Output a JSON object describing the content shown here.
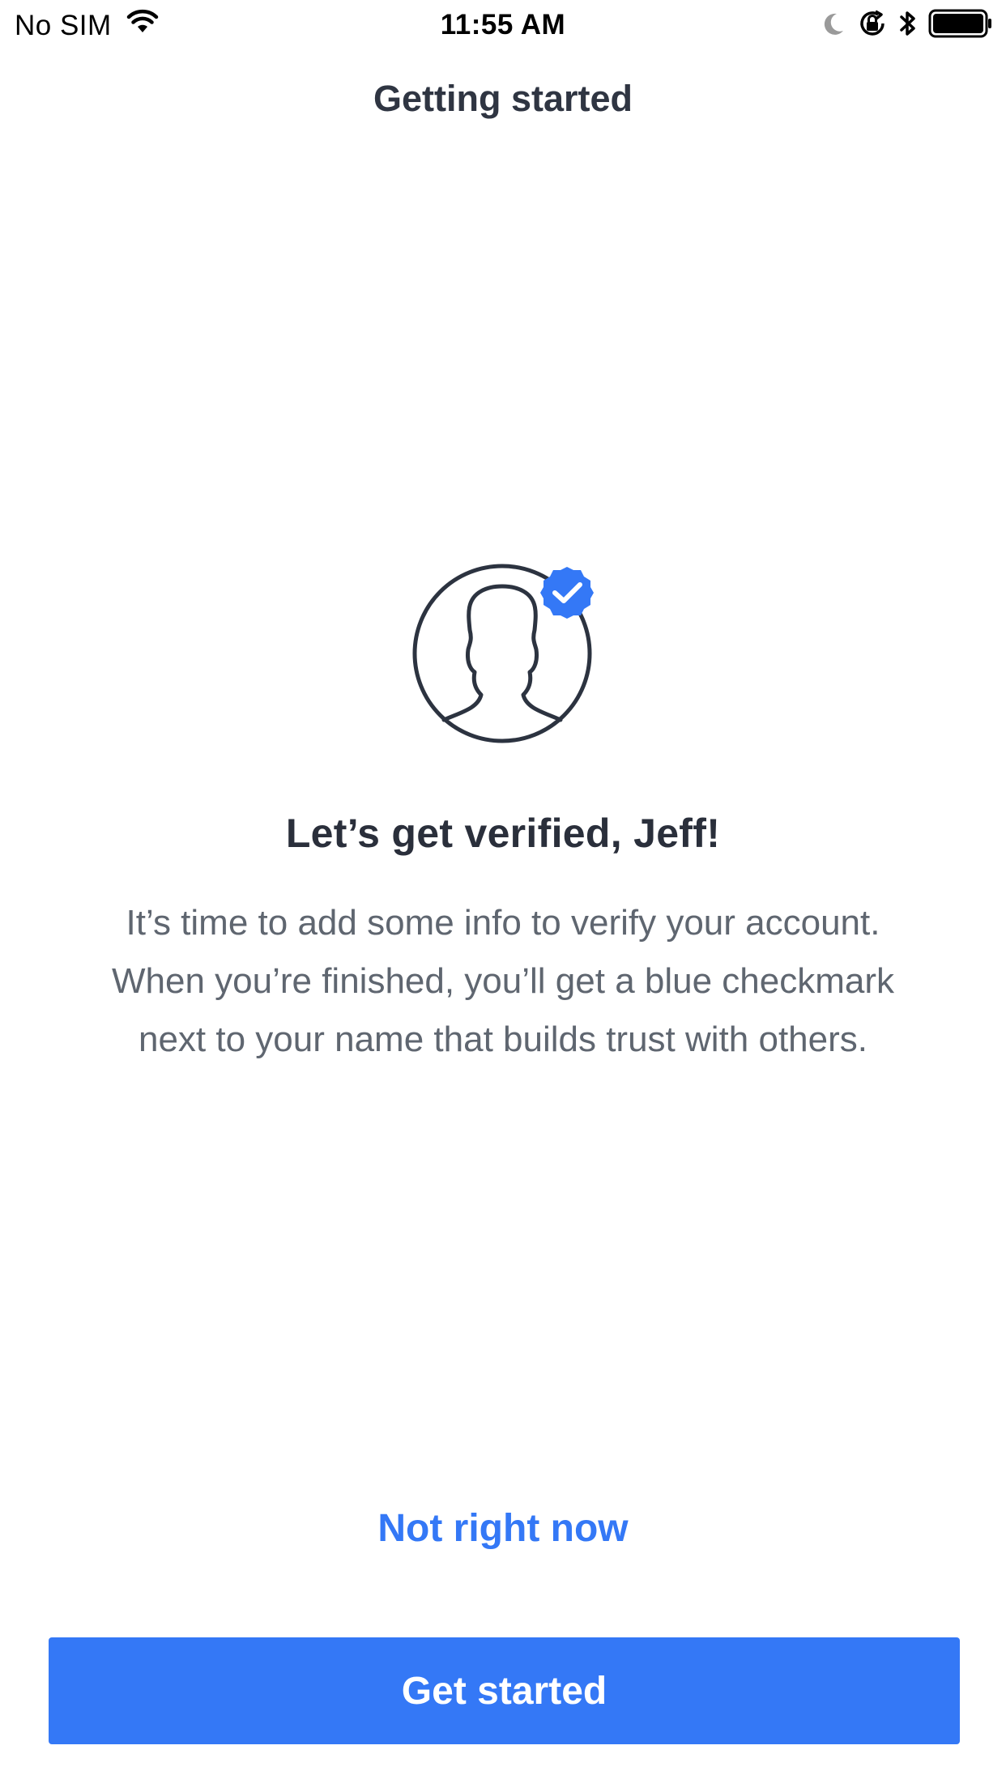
{
  "status_bar": {
    "carrier": "No SIM",
    "time": "11:55 AM",
    "icons": [
      "wifi-icon",
      "moon-icon",
      "rotation-lock-icon",
      "bluetooth-icon",
      "battery-icon"
    ]
  },
  "header": {
    "title": "Getting started"
  },
  "main": {
    "illustration": "verified-avatar-icon",
    "headline": "Let’s get verified, Jeff!",
    "description_lines": [
      "It’s time to add some info to verify your account.",
      "When you’re finished, you’ll get a blue checkmark",
      "next to your name that builds trust with others."
    ]
  },
  "actions": {
    "secondary_label": "Not right now",
    "primary_label": "Get started"
  },
  "colors": {
    "accent": "#3478f6",
    "text_dark": "#2f3542",
    "text_body": "#5f6670",
    "background": "#ffffff"
  }
}
